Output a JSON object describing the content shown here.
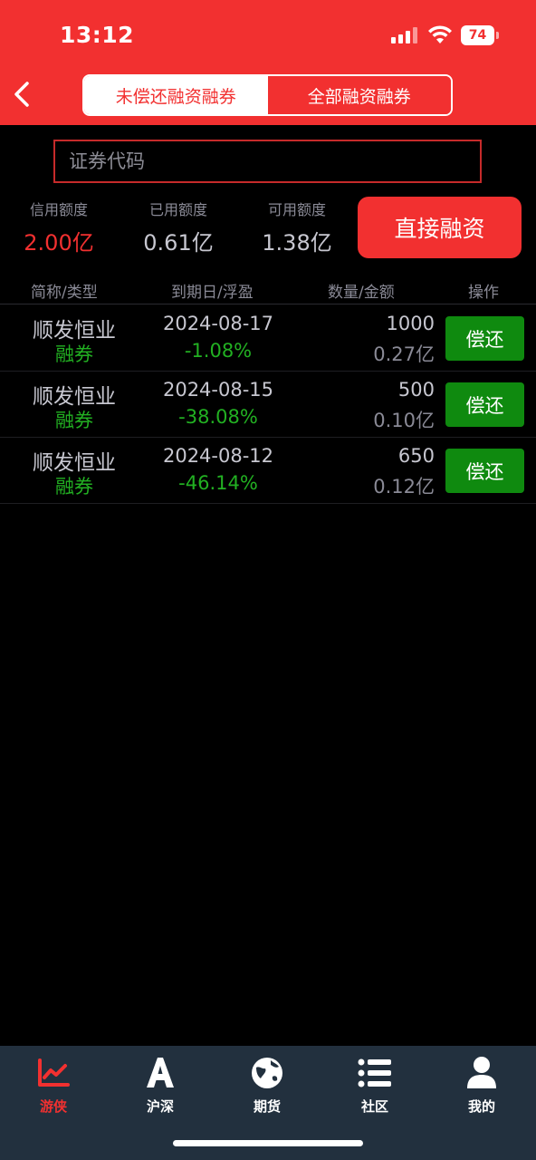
{
  "status_bar": {
    "time": "13:12",
    "battery": "74"
  },
  "header": {
    "tabs": [
      {
        "label": "未偿还融资融券",
        "active": true
      },
      {
        "label": "全部融资融券",
        "active": false
      }
    ]
  },
  "search": {
    "placeholder": "证券代码",
    "value": ""
  },
  "stats": [
    {
      "label": "信用额度",
      "value": "2.00亿"
    },
    {
      "label": "已用额度",
      "value": "0.61亿"
    },
    {
      "label": "可用额度",
      "value": "1.38亿"
    }
  ],
  "direct_financing_label": "直接融资",
  "table": {
    "headers": [
      "简称/类型",
      "到期日/浮盈",
      "数量/金额",
      "操作"
    ],
    "rows": [
      {
        "name": "顺发恒业",
        "type": "融券",
        "date": "2024-08-17",
        "pnl": "-1.08%",
        "qty": "1000",
        "amount": "0.27亿",
        "action": "偿还"
      },
      {
        "name": "顺发恒业",
        "type": "融券",
        "date": "2024-08-15",
        "pnl": "-38.08%",
        "qty": "500",
        "amount": "0.10亿",
        "action": "偿还"
      },
      {
        "name": "顺发恒业",
        "type": "融券",
        "date": "2024-08-12",
        "pnl": "-46.14%",
        "qty": "650",
        "amount": "0.12亿",
        "action": "偿还"
      }
    ]
  },
  "tabbar": {
    "items": [
      {
        "label": "游侠",
        "icon": "chart-icon",
        "active": true
      },
      {
        "label": "沪深",
        "icon": "letter-a-icon",
        "active": false
      },
      {
        "label": "期货",
        "icon": "globe-icon",
        "active": false
      },
      {
        "label": "社区",
        "icon": "list-icon",
        "active": false
      },
      {
        "label": "我的",
        "icon": "person-icon",
        "active": false
      }
    ]
  },
  "colors": {
    "brand_red": "#f23030",
    "profit_green": "#22b022",
    "button_green": "#0f8a0f",
    "tabbar_bg": "#22303e"
  }
}
